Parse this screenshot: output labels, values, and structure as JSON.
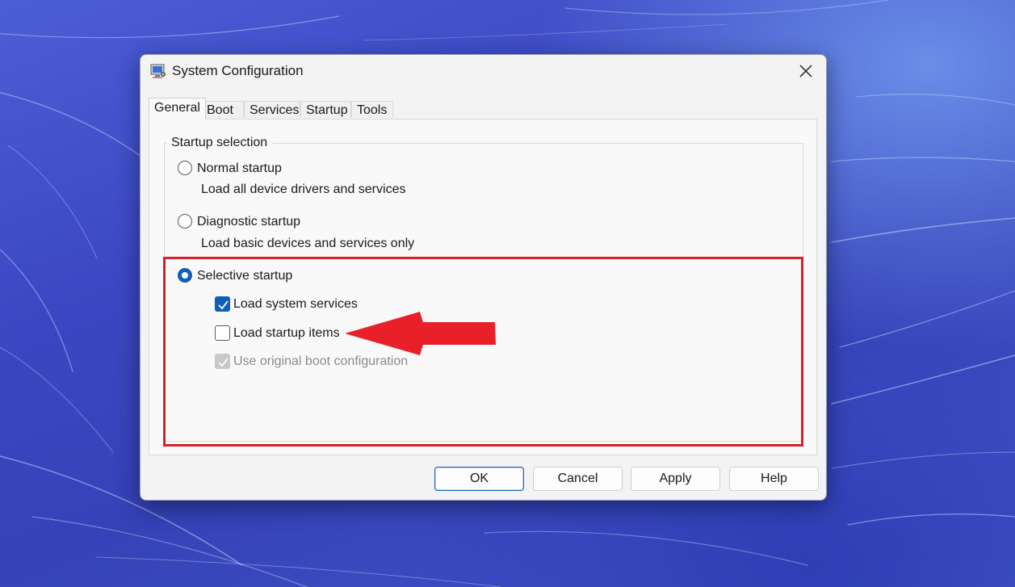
{
  "window": {
    "title": "System Configuration",
    "icon": "msconfig-icon",
    "close_icon": "close-icon"
  },
  "tabs": [
    {
      "label": "General",
      "active": true
    },
    {
      "label": "Boot",
      "active": false
    },
    {
      "label": "Services",
      "active": false
    },
    {
      "label": "Startup",
      "active": false
    },
    {
      "label": "Tools",
      "active": false
    }
  ],
  "general": {
    "group_label": "Startup selection",
    "normal": {
      "label": "Normal startup",
      "description": "Load all device drivers and services",
      "selected": false
    },
    "diagnostic": {
      "label": "Diagnostic startup",
      "description": "Load basic devices and services only",
      "selected": false
    },
    "selective": {
      "label": "Selective startup",
      "selected": true
    },
    "load_system_services": {
      "label": "Load system services",
      "checked": true,
      "enabled": true
    },
    "load_startup_items": {
      "label": "Load startup items",
      "checked": false,
      "enabled": true
    },
    "use_original_boot": {
      "label": "Use original boot configuration",
      "checked": true,
      "enabled": false
    }
  },
  "buttons": {
    "ok": "OK",
    "cancel": "Cancel",
    "apply": "Apply",
    "help": "Help"
  },
  "annotation": {
    "highlight_color": "#d6202a",
    "arrow_color": "#e8202a"
  },
  "colors": {
    "accent": "#0f5fb5",
    "dialog_bg": "#f3f3f3",
    "panel_bg": "#f9f9f9"
  }
}
